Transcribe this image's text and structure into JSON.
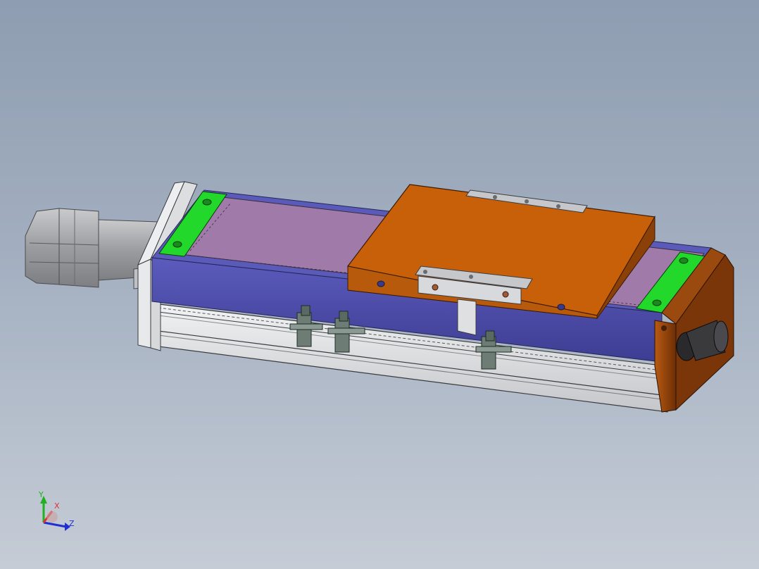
{
  "scene": {
    "background_top": "#8e9db1",
    "background_bottom": "#c5ccd6",
    "colors": {
      "carriage": "#c8600a",
      "end_pad": "#22d82a",
      "blue_cover": "#4a4aa6",
      "strip_cover": "#a07aa8",
      "aluminum": "#d8dadc",
      "motor": "#a9aaad"
    }
  },
  "triad": {
    "x_label": "X",
    "y_label": "Y",
    "z_label": "Z",
    "x_color": "#e03030",
    "y_color": "#20b020",
    "z_color": "#2030d0"
  }
}
